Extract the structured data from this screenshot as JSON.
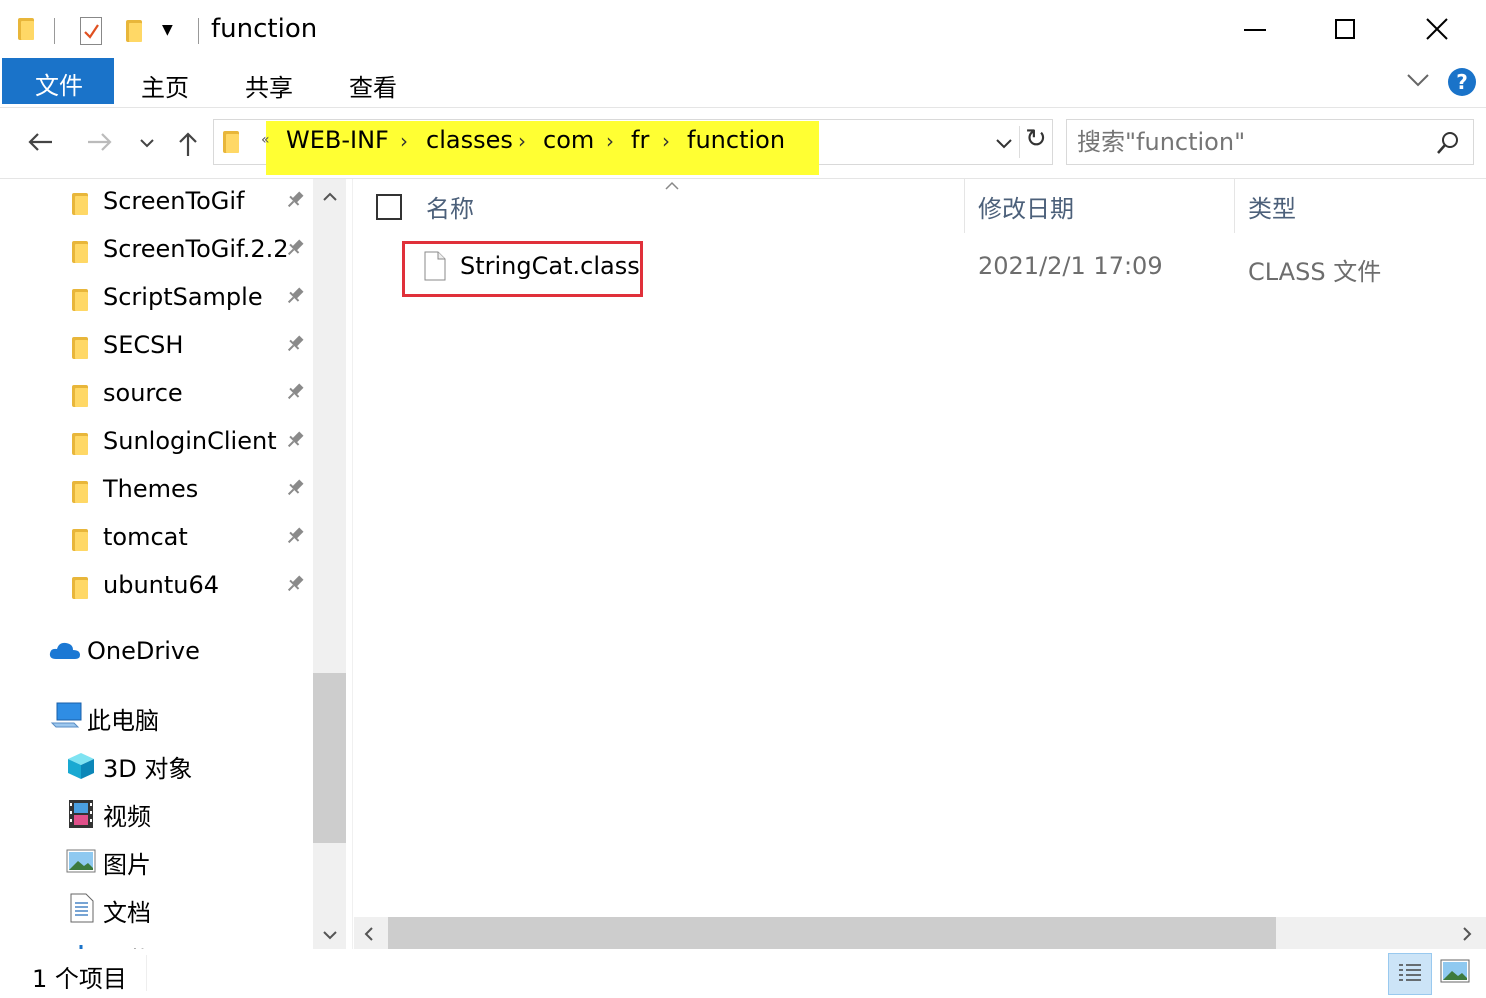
{
  "window": {
    "title": "function"
  },
  "ribbon": {
    "tabs": [
      "文件",
      "主页",
      "共享",
      "查看"
    ]
  },
  "address": {
    "overflow": "«",
    "crumbs": [
      "WEB-INF",
      "classes",
      "com",
      "fr",
      "function"
    ]
  },
  "search": {
    "placeholder": "搜索\"function\""
  },
  "sidebar": {
    "quick_access": [
      "ScreenToGif",
      "ScreenToGif.2.2",
      "ScriptSample",
      "SECSH",
      "source",
      "SunloginClient",
      "Themes",
      "tomcat",
      "ubuntu64"
    ],
    "onedrive": "OneDrive",
    "this_pc": "此电脑",
    "pc_items": [
      "3D 对象",
      "视频",
      "图片",
      "文档",
      "下载"
    ]
  },
  "columns": {
    "name": "名称",
    "date": "修改日期",
    "type": "类型"
  },
  "files": [
    {
      "name": "StringCat.class",
      "date": "2021/2/1 17:09",
      "type": "CLASS 文件"
    }
  ],
  "status": {
    "count": "1 个项目"
  },
  "colors": {
    "accent": "#1a73c9",
    "highlight": "#ffff33",
    "selection_box": "#e0303a"
  }
}
